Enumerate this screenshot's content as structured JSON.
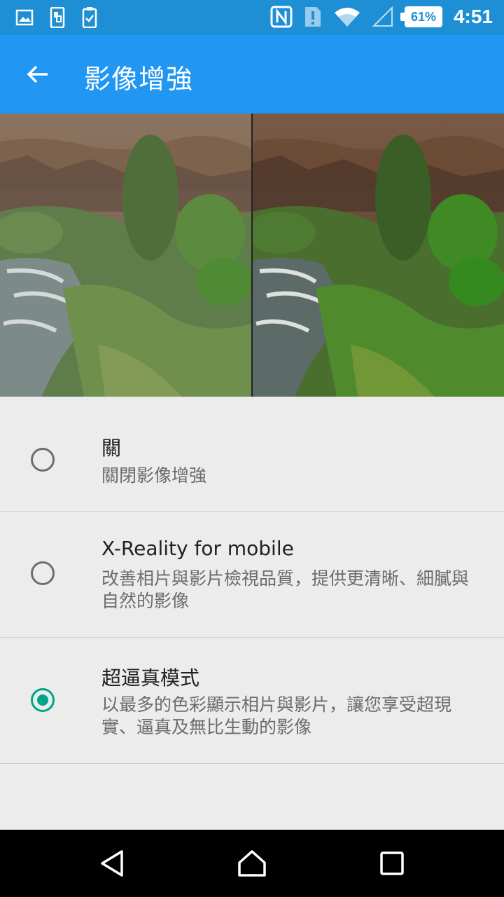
{
  "status_bar": {
    "battery": "61%",
    "time": "4:51",
    "left_icons": [
      "gallery-icon",
      "phone-transfer-icon",
      "clipboard-check-icon"
    ],
    "right_icons": [
      "nfc-icon",
      "sim-alert-icon",
      "wifi-icon",
      "cellular-signal-icon",
      "battery-icon"
    ]
  },
  "app_bar": {
    "title": "影像增強",
    "back_icon": "back-arrow-icon"
  },
  "preview": {
    "left_label": "",
    "right_label": ""
  },
  "options": [
    {
      "title": "關",
      "description": "關閉影像增強",
      "selected": false
    },
    {
      "title": "X-Reality for mobile",
      "description": "改善相片與影片檢視品質，提供更清晰、細膩與自然的影像",
      "selected": false
    },
    {
      "title": "超逼真模式",
      "description": "以最多的色彩顯示相片與影片，讓您享受超現實、逼真及無比生動的影像",
      "selected": true
    }
  ],
  "nav": {
    "icons": [
      "back-triangle-icon",
      "home-icon",
      "recents-icon"
    ]
  },
  "colors": {
    "status_bar": "#1e8fd4",
    "app_bar": "#2196f3",
    "accent": "#00a48a",
    "background": "#ececec"
  }
}
